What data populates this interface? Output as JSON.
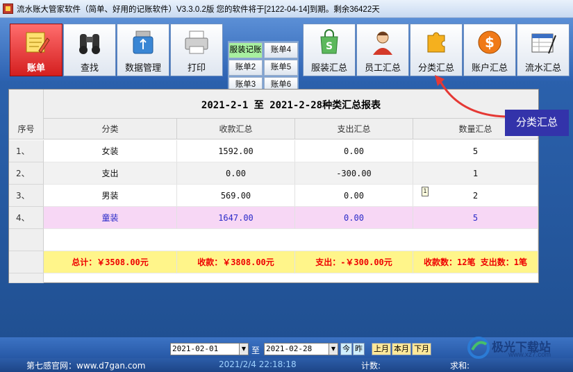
{
  "window": {
    "title": "流水账大管家软件（简单、好用的记账软件）V3.3.0.2版 您的软件将于[2122-04-14]到期。剩余36422天"
  },
  "toolbar": {
    "buttons": [
      {
        "label": "账单",
        "icon": "notebook-pencil-icon",
        "active": true
      },
      {
        "label": "查找",
        "icon": "binoculars-icon"
      },
      {
        "label": "数据管理",
        "icon": "usb-drive-icon"
      },
      {
        "label": "打印",
        "icon": "printer-icon"
      }
    ],
    "accounts": [
      "服装记账",
      "账单4",
      "账单2",
      "账单5",
      "账单3",
      "账单6"
    ],
    "summaries": [
      {
        "label": "服装汇总",
        "icon": "shopping-bag-icon"
      },
      {
        "label": "员工汇总",
        "icon": "employee-icon"
      },
      {
        "label": "分类汇总",
        "icon": "puzzle-icon"
      },
      {
        "label": "账户汇总",
        "icon": "dollar-icon"
      },
      {
        "label": "流水汇总",
        "icon": "ledger-icon"
      }
    ]
  },
  "report": {
    "title": "2021-2-1 至 2021-2-28种类汇总报表",
    "columns": [
      "序号",
      "分类",
      "收款汇总",
      "支出汇总",
      "数量汇总"
    ],
    "rows": [
      {
        "no": "1、",
        "category": "女装",
        "income": "1592.00",
        "expense": "0.00",
        "qty": "5"
      },
      {
        "no": "2、",
        "category": "支出",
        "income": "0.00",
        "expense": "-300.00",
        "qty": "1"
      },
      {
        "no": "3、",
        "category": "男装",
        "income": "569.00",
        "expense": "0.00",
        "qty": "2"
      },
      {
        "no": "4、",
        "category": "童装",
        "income": "1647.00",
        "expense": "0.00",
        "qty": "5"
      }
    ],
    "summary": {
      "total": "总计：￥3508.00元",
      "income": "收款：￥3808.00元",
      "expense": "支出：-￥300.00元",
      "counts": "收款数：12笔  支出数：1笔"
    },
    "note_marker": "1"
  },
  "callout": {
    "label": "分类汇总"
  },
  "date_range": {
    "start": "2021-02-01",
    "to_label": "至",
    "end": "2021-02-28",
    "today_label": "今",
    "yesterday_label": "昨",
    "last_month_label": "上月",
    "this_month_label": "本月",
    "next_month_label": "下月"
  },
  "statusbar": {
    "website": "第七感官网：www.d7gan.com",
    "datetime": "2021/2/4 22:18:18",
    "count_label": "计数:",
    "sum_label": "求和:"
  },
  "watermark": {
    "text": "极光下载站",
    "sub": "www.xz7.com"
  }
}
